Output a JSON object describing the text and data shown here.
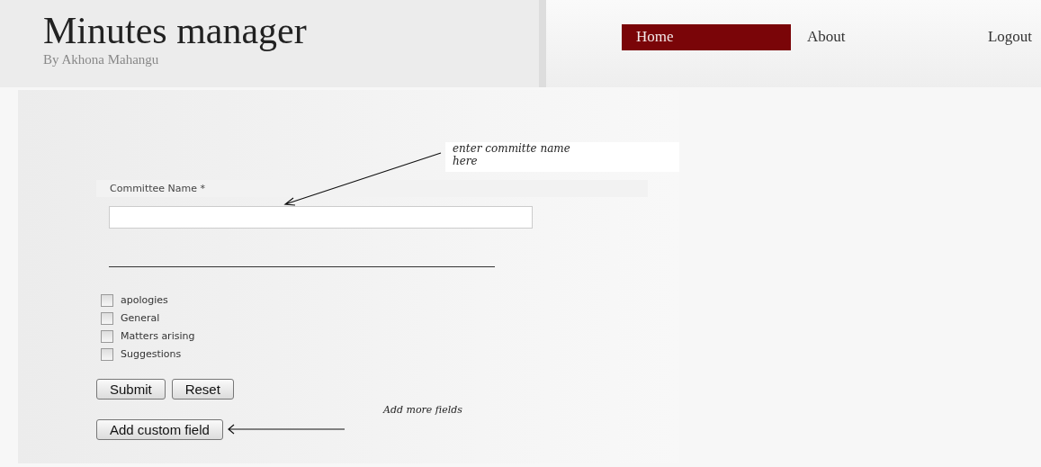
{
  "header": {
    "title": "Minutes manager",
    "subtitle": "By Akhona Mahangu"
  },
  "nav": [
    {
      "label": "Home",
      "selected": true
    },
    {
      "label": "About",
      "selected": false
    },
    {
      "label": "Logout",
      "selected": false
    }
  ],
  "form": {
    "field_label": "Committee Name *",
    "checkboxes": [
      {
        "label": "apologies",
        "checked": false
      },
      {
        "label": "General",
        "checked": false
      },
      {
        "label": "Matters arising",
        "checked": false
      },
      {
        "label": "Suggestions",
        "checked": false
      }
    ],
    "buttons": [
      "Submit",
      "Reset"
    ],
    "add_button": "Add custom field"
  },
  "annotations": {
    "field_note": "enter committe name here",
    "add_note": "Add more fields"
  }
}
